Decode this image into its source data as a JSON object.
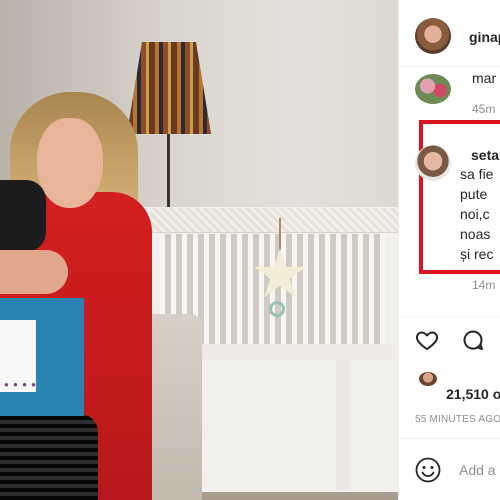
{
  "post_photo": {
    "alt_subject": "post-photo",
    "accent_colors": {
      "dress": "#d31f1f",
      "box": "#2a84b3",
      "crib": "#f2f0ed"
    }
  },
  "header": {
    "username": "ginap"
  },
  "comments": [
    {
      "text_fragment": "mar",
      "time": "45m"
    },
    {
      "username": "setar",
      "lines": [
        "sa fie",
        "pute",
        "noi,c",
        "noas",
        "și rec"
      ],
      "time": "14m",
      "highlight_color": "#d9141f"
    }
  ],
  "actions": {
    "like_icon": "heart-icon",
    "comment_icon": "comment-icon"
  },
  "likes": {
    "text": "21,510 o"
  },
  "post_time": "55 MINUTES AGO",
  "composer": {
    "emoji_icon": "emoji-icon",
    "placeholder": "Add a"
  }
}
